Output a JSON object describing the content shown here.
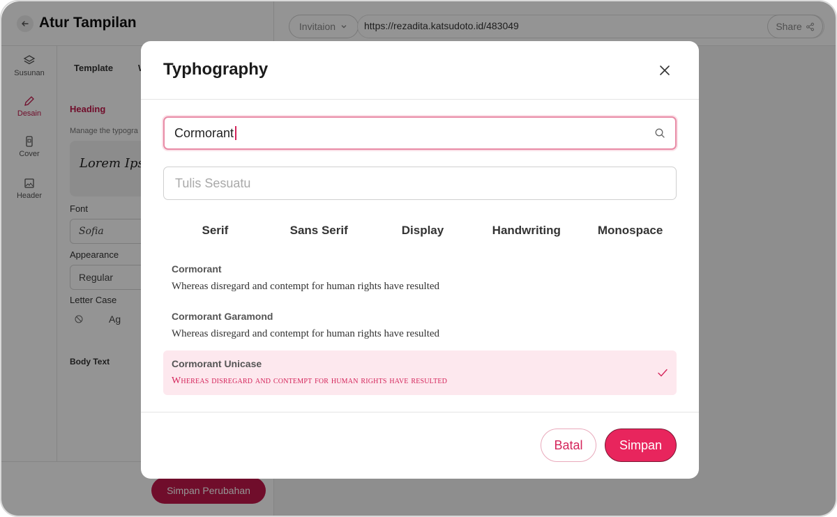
{
  "app": {
    "title": "Atur Tampilan",
    "invitation_select": "Invitaion",
    "url": "https://rezadita.katsudoto.id/483049",
    "share_label": "Share",
    "save_changes_label": "Simpan Perubahan"
  },
  "rail": {
    "items": [
      {
        "label": "Susunan"
      },
      {
        "label": "Desain"
      },
      {
        "label": "Cover"
      },
      {
        "label": "Header"
      }
    ]
  },
  "panel": {
    "tabs": [
      "Template",
      "W"
    ],
    "heading": "Heading",
    "description": "Manage the typogra",
    "preview_text": "Lorem Ipsu",
    "font_label": "Font",
    "font_value": "Sofia",
    "appearance_label": "Appearance",
    "appearance_value": "Regular",
    "letter_case_label": "Letter Case",
    "letter_case_option": "Ag",
    "body_text_label": "Body Text"
  },
  "modal": {
    "title": "Typhography",
    "search_value": "Cormorant",
    "text_placeholder": "Tulis Sesuatu",
    "categories": [
      "Serif",
      "Sans Serif",
      "Display",
      "Handwriting",
      "Monospace"
    ],
    "fonts": [
      {
        "name": "Cormorant",
        "sample": "Whereas disregard and contempt for human rights have resulted"
      },
      {
        "name": "Cormorant Garamond",
        "sample": "Whereas disregard and contempt for human rights have resulted"
      },
      {
        "name": "Cormorant Unicase",
        "sample": "Whereas disregard and contempt for human rights have resulted",
        "selected": true
      }
    ],
    "cancel_label": "Batal",
    "save_label": "Simpan"
  },
  "colors": {
    "accent": "#e8255d",
    "accent_dark": "#c2184a",
    "selected_bg": "#fde8ee"
  }
}
